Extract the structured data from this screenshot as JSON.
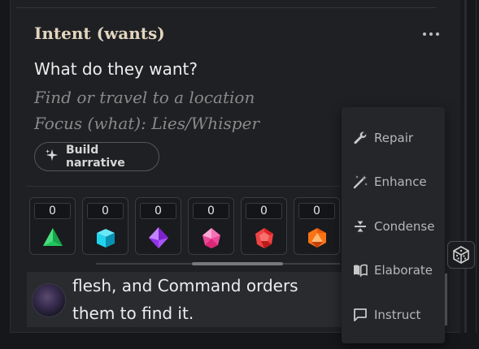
{
  "intent": {
    "title": "Intent (wants)",
    "question": "What do they want?",
    "suggestions": [
      "Find or travel to a location",
      "Focus (what): Lies/Whisper"
    ],
    "build_button": "Build narrative"
  },
  "dice": [
    {
      "icon": "d4-icon",
      "count": "0",
      "color": "#22c55e"
    },
    {
      "icon": "d6-icon",
      "count": "0",
      "color": "#22d3ee"
    },
    {
      "icon": "d8-icon",
      "count": "0",
      "color": "#a855f7"
    },
    {
      "icon": "d10-icon",
      "count": "0",
      "color": "#ec4899"
    },
    {
      "icon": "d12-icon",
      "count": "0",
      "color": "#ef4444"
    },
    {
      "icon": "d20-icon",
      "count": "0",
      "color": "#f97316"
    }
  ],
  "chat": {
    "lines": [
      "flesh, and Command orders",
      "them to find it."
    ]
  },
  "menu": {
    "items": [
      {
        "label": "Repair",
        "icon": "wrench-icon"
      },
      {
        "label": "Enhance",
        "icon": "magic-wand-icon"
      },
      {
        "label": "Condense",
        "icon": "condense-icon"
      },
      {
        "label": "Elaborate",
        "icon": "open-book-icon"
      },
      {
        "label": "Instruct",
        "icon": "message-icon"
      }
    ]
  },
  "dice_button": {
    "icon": "dice-icon"
  }
}
